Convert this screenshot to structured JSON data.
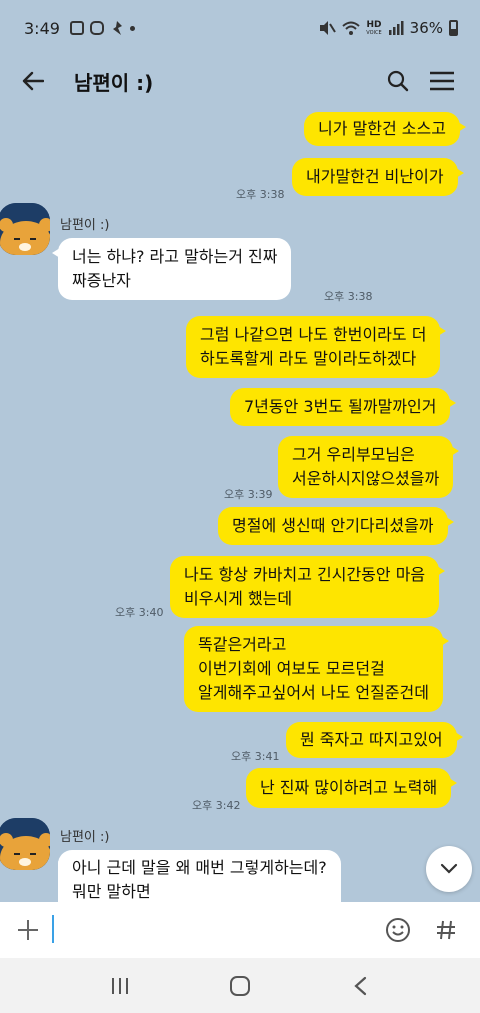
{
  "status_bar": {
    "time": "3:49",
    "signal_label": "HD",
    "signal_sub": "VOICE",
    "battery": "36%"
  },
  "header": {
    "title": "남편이 :)"
  },
  "messages": [
    {
      "side": "me",
      "lines": [
        "니가 말한건 소스고"
      ]
    },
    {
      "side": "me",
      "lines": [
        "내가말한건 비난이가"
      ],
      "time": "오후 3:38"
    },
    {
      "side": "other",
      "sender": "남편이 :)",
      "lines": [
        "너는 하냐? 라고 말하는거 진짜",
        "짜증난자"
      ],
      "time": "오후 3:38"
    },
    {
      "side": "me",
      "lines": [
        "그럼 나같으면 나도 한번이라도 더",
        "하도록할게 라도 말이라도하겠다"
      ]
    },
    {
      "side": "me",
      "lines": [
        "7년동안 3번도 될까말까인거"
      ]
    },
    {
      "side": "me",
      "lines": [
        "그거 우리부모님은",
        "서운하시지않으셨을까"
      ],
      "time": "오후 3:39"
    },
    {
      "side": "me",
      "lines": [
        "명절에 생신때 안기다리셨을까"
      ]
    },
    {
      "side": "me",
      "lines": [
        "나도 항상 카바치고 긴시간동안 마음",
        "비우시게 했는데"
      ],
      "time": "오후 3:40"
    },
    {
      "side": "me",
      "lines": [
        "똑같은거라고",
        "이번기회에 여보도 모르던걸",
        "알게해주고싶어서 나도 언질준건데"
      ]
    },
    {
      "side": "me",
      "lines": [
        "뭔 죽자고 따지고있어"
      ],
      "time": "오후 3:41"
    },
    {
      "side": "me",
      "lines": [
        "난 진짜 많이하려고 노력해"
      ],
      "time": "오후 3:42"
    },
    {
      "side": "other",
      "sender": "남편이 :)",
      "lines": [
        "아니 근데 말을 왜 매번 그렇게하는데?",
        "뭐만 말하면"
      ]
    }
  ],
  "input": {
    "value": "",
    "placeholder": ""
  },
  "colors": {
    "chat_background": "#b2c7d9",
    "my_bubble": "#fee500",
    "other_bubble": "#ffffff",
    "cursor": "#3aa1e6"
  },
  "icons": [
    "back-arrow-icon",
    "search-icon",
    "menu-icon",
    "plus-icon",
    "emoji-icon",
    "hash-icon",
    "chevron-down-icon",
    "recents-icon",
    "home-icon",
    "back-nav-icon"
  ]
}
